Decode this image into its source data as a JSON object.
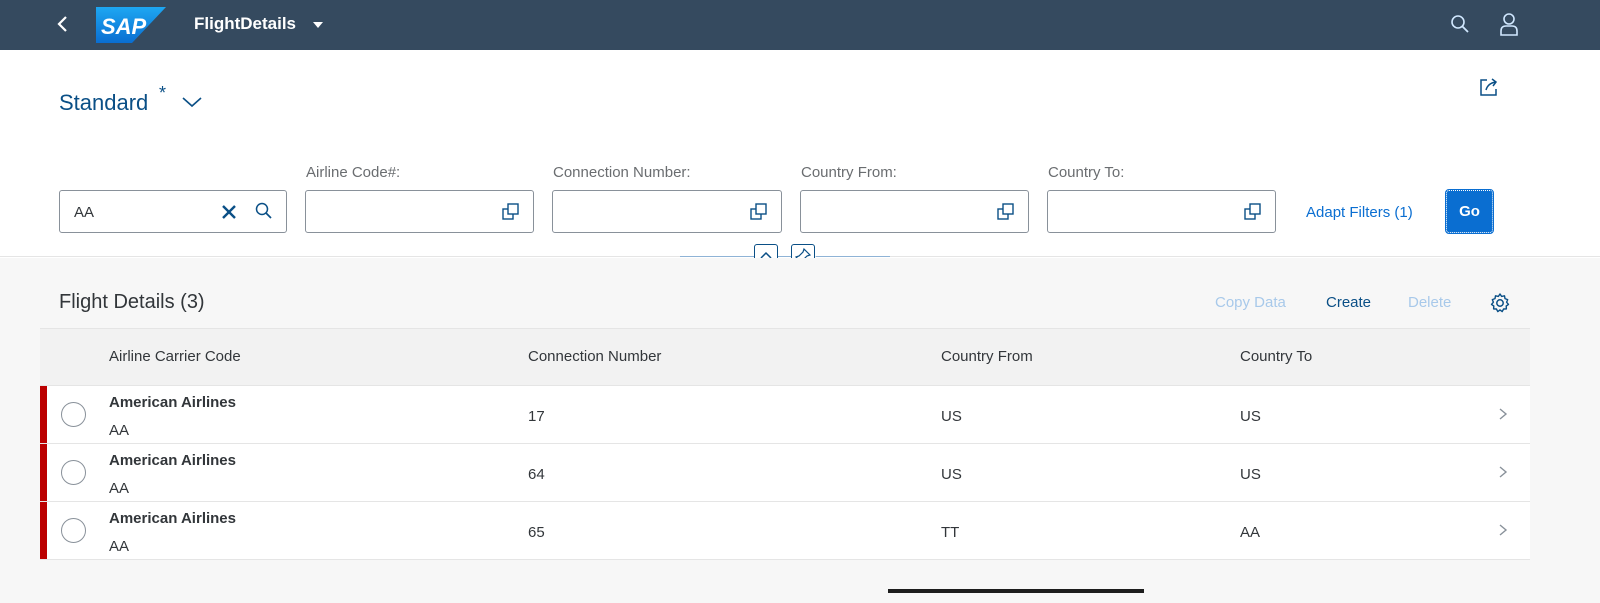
{
  "shell": {
    "title": "FlightDetails",
    "logo_text": "SAP"
  },
  "variant": {
    "name": "Standard",
    "modified_marker": "*"
  },
  "filters": {
    "search_value": "AA",
    "fields": [
      {
        "label": "Airline Code#:",
        "value": ""
      },
      {
        "label": "Connection Number:",
        "value": ""
      },
      {
        "label": "Country From:",
        "value": ""
      },
      {
        "label": "Country To:",
        "value": ""
      }
    ],
    "adapt_filters_label": "Adapt Filters (1)",
    "go_label": "Go"
  },
  "table": {
    "title": "Flight Details (3)",
    "toolbar": {
      "copy_label": "Copy Data",
      "create_label": "Create",
      "delete_label": "Delete"
    },
    "columns": [
      "Airline Carrier Code",
      "Connection Number",
      "Country From",
      "Country To"
    ],
    "rows": [
      {
        "airline_name": "American Airlines",
        "airline_code": "AA",
        "connection": "17",
        "country_from": "US",
        "country_to": "US"
      },
      {
        "airline_name": "American Airlines",
        "airline_code": "AA",
        "connection": "64",
        "country_from": "US",
        "country_to": "US"
      },
      {
        "airline_name": "American Airlines",
        "airline_code": "AA",
        "connection": "65",
        "country_from": "TT",
        "country_to": "AA"
      }
    ]
  },
  "colors": {
    "shell_bg": "#354a5f",
    "accent": "#0a6ed1",
    "link": "#0a4f86",
    "row_marker": "#bb0000"
  }
}
